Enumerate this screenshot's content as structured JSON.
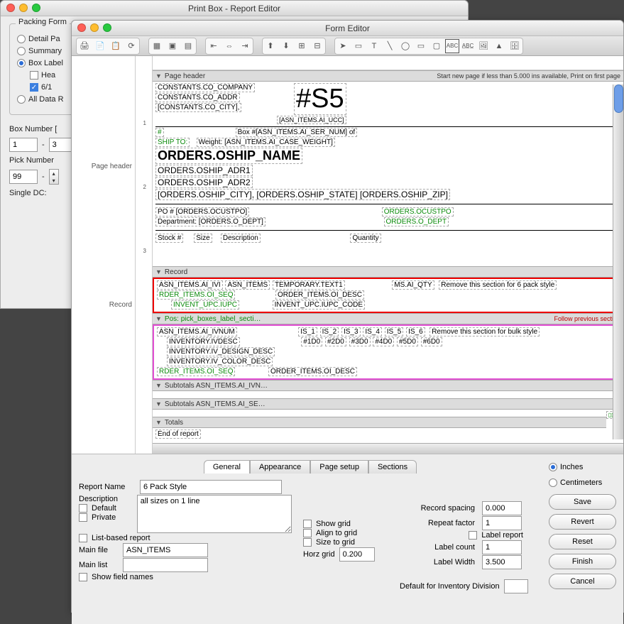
{
  "back_window": {
    "title": "Print Box - Report Editor",
    "group_title": "Packing Form",
    "radios": {
      "detail": "Detail Pa",
      "summary": "Summary",
      "box_label": "Box Label",
      "all_data": "All Data R"
    },
    "box_sub": {
      "hea": "Hea",
      "six": "6/1"
    },
    "box_number_label": "Box Number [",
    "box_number_from": "1",
    "box_number_to": "3",
    "pick_number_label": "Pick Number",
    "pick_number_val": "99",
    "single_dc": "Single DC:"
  },
  "front_window": {
    "title": "Form Editor",
    "left_gutter": {
      "page_header": "Page header",
      "record": "Record"
    },
    "page_header_section": {
      "label": "Page header",
      "right_note": "Start new page if less than 5.000 ins available, Print on first page",
      "company": "CONSTANTS.CO_COMPANY",
      "addr": "CONSTANTS.CO_ADDR",
      "city": "[CONSTANTS.CO_CITY],",
      "s5": "#S5",
      "ucc": "[ASN_ITEMS.AI_UCC]",
      "box_line": "Box #[ASN_ITEMS.AI_SER_NUM] of",
      "ship_to": "SHIP TO:",
      "weight": "Weight: [ASN_ITEMS.AI_CASE_WEIGHT]",
      "oship_name": "ORDERS.OSHIP_NAME",
      "oship_adr1": "ORDERS.OSHIP_ADR1",
      "oship_adr2": "ORDERS.OSHIP_ADR2",
      "oship_city": "[ORDERS.OSHIP_CITY], [ORDERS.OSHIP_STATE] [ORDERS.OSHIP_ZIP]",
      "po_line": "PO # [ORDERS.OCUSTPO]",
      "ocustpo": "ORDERS.OCUSTPO",
      "dept_line": "Department: [ORDERS.O_DEPT]",
      "odept": "ORDERS.O_DEPT",
      "col_stock": "Stock #",
      "col_size": "Size",
      "col_desc": "Description",
      "col_qty": "Quantity"
    },
    "record_section": {
      "label": "Record",
      "line1a": "ASN_ITEMS.AI_IVI",
      "line1b": "ASN_ITEMS",
      "line1c": "TEMPORARY.TEXT1",
      "line1d": "MS.AI_QTY",
      "note": "Remove this section for 6 pack style",
      "line2a": "RDER_ITEMS.OI_SEQ",
      "line2b": "ORDER_ITEMS.OI_DESC",
      "line3a": "INVENT_UPC.IUPC",
      "line3b": "INVENT_UPC.IUPC_CODE"
    },
    "pos_section": {
      "label": "Pos: pick_boxes_label_secti…",
      "right_note": "Follow previous section",
      "l1": "ASN_ITEMS.AI_IVNUM",
      "is": [
        "IS_1",
        "IS_2",
        "IS_3",
        "IS_4",
        "IS_5",
        "IS_6"
      ],
      "note": "Remove this section for bulk style",
      "l2": "INVENTORY.IVDESC",
      "d": [
        "#1D0",
        "#2D0",
        "#3D0",
        "#4D0",
        "#5D0",
        "#6D0"
      ],
      "l3": "INVENTORY.IV_DESIGN_DESC",
      "l4": "INVENTORY.IV_COLOR_DESC",
      "l5a": "RDER_ITEMS.OI_SEQ",
      "l5b": "ORDER_ITEMS.OI_DESC"
    },
    "subtot1": "Subtotals ASN_ITEMS.AI_IVN…",
    "subtot2": "Subtotals ASN_ITEMS.AI_SE…",
    "totals": "Totals",
    "end": "End of report"
  },
  "bottom": {
    "tabs": [
      "General",
      "Appearance",
      "Page setup",
      "Sections"
    ],
    "report_name_lbl": "Report Name",
    "report_name": "6 Pack Style",
    "description_lbl": "Description",
    "description": "all sizes on 1 line",
    "cb_default": "Default",
    "cb_private": "Private",
    "cb_list_based": "List-based report",
    "cb_show_grid": "Show grid",
    "cb_align_grid": "Align to grid",
    "cb_size_grid": "Size to grid",
    "cb_show_field_names": "Show field names",
    "main_file_lbl": "Main file",
    "main_file": "ASN_ITEMS",
    "main_list_lbl": "Main list",
    "main_list": "",
    "horz_grid_lbl": "Horz grid",
    "horz_grid": "0.200",
    "record_spacing_lbl": "Record spacing",
    "record_spacing": "0.000",
    "repeat_factor_lbl": "Repeat factor",
    "repeat_factor": "1",
    "cb_label_report": "Label report",
    "label_count_lbl": "Label count",
    "label_count": "1",
    "label_width_lbl": "Label Width",
    "label_width": "3.500",
    "default_inv_lbl": "Default for Inventory Division",
    "default_inv": "",
    "units_inches": "Inches",
    "units_cm": "Centimeters",
    "btns": {
      "save": "Save",
      "revert": "Revert",
      "reset": "Reset",
      "finish": "Finish",
      "cancel": "Cancel"
    }
  }
}
